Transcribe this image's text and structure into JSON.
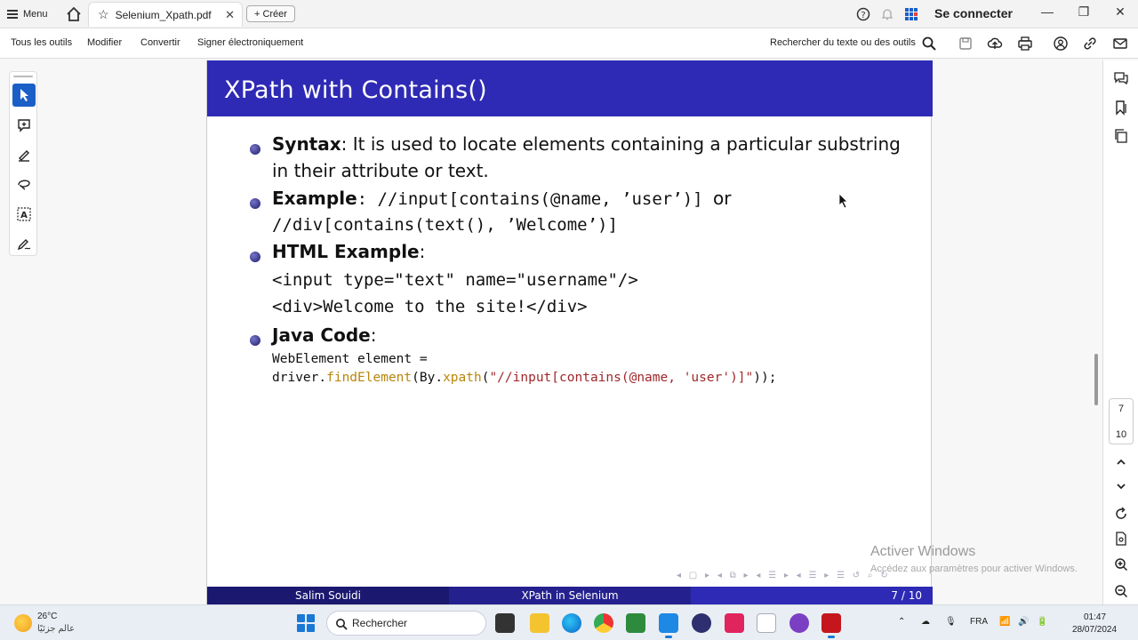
{
  "titlebar": {
    "menu_label": "Menu",
    "tab_title": "Selenium_Xpath.pdf",
    "create_label": "Créer",
    "signin_label": "Se connecter"
  },
  "toolbar": {
    "items": [
      "Tous les outils",
      "Modifier",
      "Convertir",
      "Signer électroniquement"
    ],
    "search_label": "Rechercher du texte ou des outils"
  },
  "slide": {
    "title": "XPath with Contains()",
    "syntax_label": "Syntax",
    "syntax_text1": ": It is used to locate elements containing a particular substring",
    "syntax_text2": "in their attribute or text.",
    "example_label": "Example",
    "example_code1": ": //input[contains(@name, ’user’)] ",
    "example_or": "or",
    "example_code2": "//div[contains(text(), ’Welcome’)]",
    "html_label": "HTML Example",
    "html_line1": "<input type=\"text\" name=\"username\"/>",
    "html_line2": "<div>Welcome to the site!</div>",
    "java_label": "Java Code",
    "java_line1": "WebElement element =",
    "java_line2_a": "driver.",
    "java_line2_fn": "findElement",
    "java_line2_b": "(By.",
    "java_line2_fn2": "xpath",
    "java_line2_c": "(",
    "java_line2_str": "\"//input[contains(@name, 'user')]\"",
    "java_line2_d": "));",
    "footer_author": "Salim Souidi",
    "footer_title": "XPath in Selenium",
    "footer_page": "7 / 10"
  },
  "watermark": {
    "title": "Activer Windows",
    "subtitle": "Accédez aux paramètres pour activer Windows."
  },
  "pager": {
    "current": "7",
    "total": "10"
  },
  "taskbar": {
    "temperature": "26°C",
    "weather_text": "عالم جزئيًا",
    "search_label": "Rechercher",
    "language": "FRA",
    "time": "01:47",
    "date": "28/07/2024"
  },
  "colors": {
    "beamer_blue": "#2e2ab5",
    "acrobat_red": "#c5161d",
    "accent_blue": "#1a5fc8"
  }
}
